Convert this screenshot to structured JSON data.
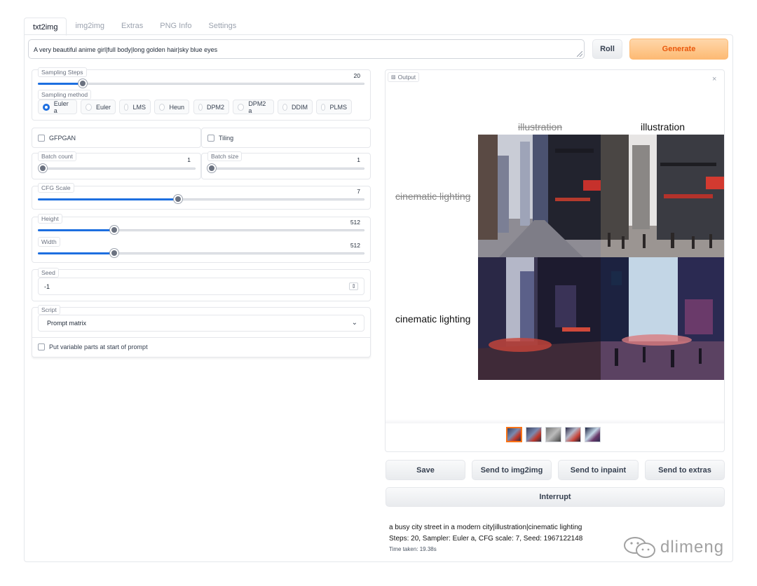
{
  "tabs": [
    "txt2img",
    "img2img",
    "Extras",
    "PNG Info",
    "Settings"
  ],
  "prompt": "A very beautiful anime girl|full body|long golden hair|sky blue eyes",
  "buttons": {
    "roll": "Roll",
    "generate": "Generate",
    "save": "Save",
    "img2img": "Send to img2img",
    "inpaint": "Send to inpaint",
    "extras": "Send to extras",
    "interrupt": "Interrupt"
  },
  "sampling_steps": {
    "label": "Sampling Steps",
    "value": "20",
    "fraction": 0.133
  },
  "sampling_method": {
    "label": "Sampling method",
    "options": [
      "Euler a",
      "Euler",
      "LMS",
      "Heun",
      "DPM2",
      "DPM2 a",
      "DDIM",
      "PLMS"
    ],
    "selected": "Euler a"
  },
  "gfpgan": {
    "label": "GFPGAN",
    "checked": false
  },
  "tiling": {
    "label": "Tiling",
    "checked": false
  },
  "batch_count": {
    "label": "Batch count",
    "value": "1",
    "fraction": 0.0
  },
  "batch_size": {
    "label": "Batch size",
    "value": "1",
    "fraction": 0.0
  },
  "cfg_scale": {
    "label": "CFG Scale",
    "value": "7",
    "fraction": 0.43
  },
  "height": {
    "label": "Height",
    "value": "512",
    "fraction": 0.23
  },
  "width": {
    "label": "Width",
    "value": "512",
    "fraction": 0.23
  },
  "seed": {
    "label": "Seed",
    "value": "-1"
  },
  "script": {
    "label": "Script",
    "value": "Prompt matrix"
  },
  "variable_parts": {
    "label": "Put variable parts at start of prompt",
    "checked": false
  },
  "output": {
    "label": "Output",
    "close_icon": "close-icon"
  },
  "matrix": {
    "col_headers": [
      "illustration",
      "illustration"
    ],
    "row_headers": [
      "cinematic lighting",
      "cinematic lighting"
    ],
    "struck_col": 0,
    "struck_row": 0
  },
  "info": {
    "prompt": "a busy city street in a modern city|illustration|cinematic lighting",
    "params": "Steps: 20, Sampler: Euler a, CFG scale: 7, Seed: 1967122148",
    "time": "Time taken: 19.38s"
  },
  "watermark": "dlimeng",
  "colors": {
    "accent": "#1d6fe0",
    "generate": "#fdba74",
    "generate_text": "#ea580c"
  }
}
